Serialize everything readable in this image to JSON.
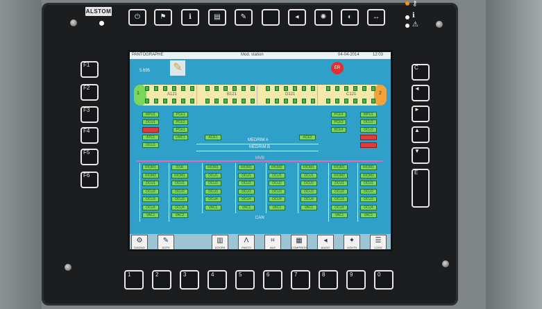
{
  "device": {
    "brand": "ALSTOM"
  },
  "header_keys": {
    "icons": [
      "power-icon",
      "flag-icon",
      "info-icon",
      "document-icon",
      "wrench-icon",
      "blank-key-icon",
      "speaker-icon",
      "brightness-icon",
      "contrast-icon",
      "arrows-icon"
    ]
  },
  "left_keys": {
    "labels": [
      "F1",
      "F2",
      "F3",
      "F4",
      "F5",
      "F6"
    ]
  },
  "right_keys": {
    "labels": [
      "C",
      "◄",
      "►",
      "▲",
      "▼",
      "E"
    ]
  },
  "bottom_keys": {
    "labels": [
      "1",
      "2",
      "3",
      "4",
      "5",
      "6",
      "7",
      "8",
      "9",
      "0"
    ]
  },
  "screen": {
    "topbar": {
      "left": "PANTOGRAPHE",
      "center": "Mod. station",
      "right_date": "04-04-2014",
      "right_time": "12:03"
    },
    "status_label": "5.695",
    "emergency_badge": "ER",
    "train": {
      "end_left": "1",
      "end_right": "2",
      "cars": [
        "A121",
        "B121",
        "D121",
        "C121"
      ]
    },
    "left_stack_a": [
      "MPU1",
      "DCU1",
      "",
      "ATC1",
      "DCU1"
    ],
    "left_stack_b": [
      "PCE1",
      "PCE2",
      "PCE1",
      "UMC1"
    ],
    "right_stack_a": [
      "PCE4",
      "PCE3",
      "BCE4"
    ],
    "right_stack_b": [
      "MPU1",
      "DCU2",
      "DCU2",
      "",
      ""
    ],
    "ace_left": "ACE1",
    "ace_right": "ACE2",
    "network_main": "MEDRIM A",
    "network_secondary": "MEDRIM B",
    "mvb_label": "MVB",
    "can_label": "CAN",
    "rio_columns": [
      [
        "RIOM1",
        "RIOM2",
        "DCU1",
        "DCU2",
        "DCU3",
        "DCU4",
        "VAC1"
      ],
      [
        "DSR",
        "RIOM1",
        "DCU1",
        "DCU2",
        "DCU3",
        "DCU4",
        "VAC2"
      ],
      [
        "RIOM1",
        "DCU1",
        "DCU2",
        "DCU3",
        "DCU4",
        "VAC1"
      ],
      [
        "RIOM1",
        "DCU1",
        "DCU2",
        "DCU3",
        "DCU4",
        "VAC1"
      ],
      [
        "RIOM2",
        "DCU1",
        "DCU2",
        "DCU3",
        "DCU4",
        "VAC1"
      ],
      [
        "RIOM1",
        "DCU1",
        "DCU2",
        "DCU3",
        "DCU4",
        "VAC1"
      ],
      [
        "RIOM1",
        "RIOM2",
        "DCU1",
        "DCU2",
        "DCU3",
        "DCU4",
        "VAC1"
      ],
      [
        "RIOM1",
        "RIOM2",
        "DCU1",
        "DCU2",
        "DCU3",
        "DCU4",
        "VAC1"
      ]
    ],
    "softkeys": [
      {
        "label": "DIAGNO",
        "icon": "tool-icon"
      },
      {
        "label": "DCPS",
        "icon": "pencil-icon"
      },
      {
        "label": "DOORS",
        "icon": "door-icon"
      },
      {
        "label": "PANTO",
        "icon": "pantograph-icon"
      },
      {
        "label": "AUX",
        "icon": "auxiliary-icon"
      },
      {
        "label": "COMPRESS",
        "icon": "compressor-icon"
      },
      {
        "label": "AUDIO",
        "icon": "speaker-icon"
      },
      {
        "label": "LIGHTS",
        "icon": "lamp-icon"
      },
      {
        "label": "LOGS",
        "icon": "log-icon"
      }
    ]
  }
}
